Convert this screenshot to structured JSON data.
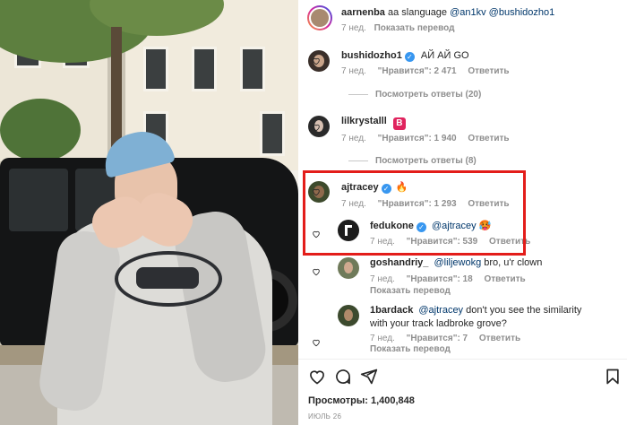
{
  "post": {
    "author": "aarnenba",
    "caption_text": "aa slanguage",
    "caption_mentions": "@an1kv @bushidozho1",
    "caption_age": "7 нед.",
    "translate_label": "Показать перевод"
  },
  "comments": [
    {
      "username": "bushidozho1",
      "text": "АЙ АЙ GO",
      "age": "7 нед.",
      "likes": "\"Нравится\": 2 471",
      "reply_label": "Ответить",
      "view_replies": "Посмотреть ответы (20)"
    },
    {
      "username": "lilkrystalll",
      "badge": "B",
      "age": "7 нед.",
      "likes": "\"Нравится\": 1 940",
      "reply_label": "Ответить",
      "view_replies": "Посмотреть ответы (8)"
    },
    {
      "username": "ajtracey",
      "text": "🔥",
      "age": "7 нед.",
      "likes": "\"Нравится\": 1 293",
      "reply_label": "Ответить"
    }
  ],
  "replies": [
    {
      "username": "fedukone",
      "mention": "@ajtracey",
      "text": "🥵",
      "age": "7 нед.",
      "likes": "\"Нравится\": 539",
      "reply_label": "Ответить"
    },
    {
      "username": "goshandriy_",
      "mention": "@liljewokg",
      "text": "bro, u'r clown",
      "age": "7 нед.",
      "likes": "\"Нравится\": 18",
      "reply_label": "Ответить",
      "translate_label": "Показать перевод"
    },
    {
      "username": "1bardack",
      "mention": "@ajtracey",
      "text_line1": "don't you see the similarity",
      "text_line2": "with your track ladbroke grove?",
      "age": "7 нед.",
      "likes": "\"Нравится\": 7",
      "reply_label": "Ответить",
      "translate_label": "Показать перевод"
    }
  ],
  "stats": {
    "views": "Просмотры: 1,400,848",
    "date": "ИЮЛЬ 26"
  },
  "icons": {
    "like": "heart-icon",
    "comment": "comment-icon",
    "share": "paper-plane-icon",
    "save": "bookmark-icon",
    "verified": "verified-badge-icon"
  },
  "colors": {
    "highlight_box": "#e31d1a",
    "verified": "#3897f0",
    "mention": "#00376b",
    "muted_text": "#8e8e8e",
    "badge_red": "#e0245e"
  }
}
